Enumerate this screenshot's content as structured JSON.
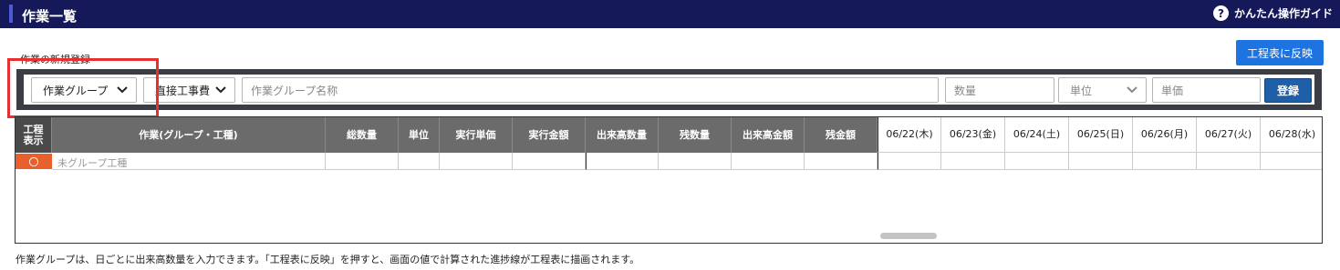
{
  "header": {
    "title": "作業一覧",
    "guide_label": "かんたん操作ガイド",
    "help_icon": "question-circle-icon"
  },
  "form": {
    "section_label": "作業の新規登録",
    "reflect_button": "工程表に反映",
    "type_select": "作業グループ",
    "cost_select": "直接工事費",
    "name_placeholder": "作業グループ名称",
    "quantity_placeholder": "数量",
    "unit_select": "単位",
    "unit_price_placeholder": "単価",
    "register_button": "登録"
  },
  "table": {
    "columns": [
      "工程\n表示",
      "作業(グループ・工種)",
      "総数量",
      "単位",
      "実行単価",
      "実行金額",
      "出来高数量",
      "残数量",
      "出来高金額",
      "残金額"
    ],
    "dates": [
      "06/22(木)",
      "06/23(金)",
      "06/24(土)",
      "06/25(日)",
      "06/26(月)",
      "06/27(火)",
      "06/28(水)"
    ],
    "rows": [
      {
        "flag": "〇",
        "name": "未グループ工種"
      }
    ]
  },
  "footnote": "作業グループは、日ごとに出来高数量を入力できます。「工程表に反映」を押すと、画面の値で計算された進捗線が工程表に描画されます。",
  "colors": {
    "topbar": "#15195a",
    "accent_blue": "#1d74e0",
    "highlight_red": "#e53030",
    "flag_orange": "#e8612c"
  }
}
